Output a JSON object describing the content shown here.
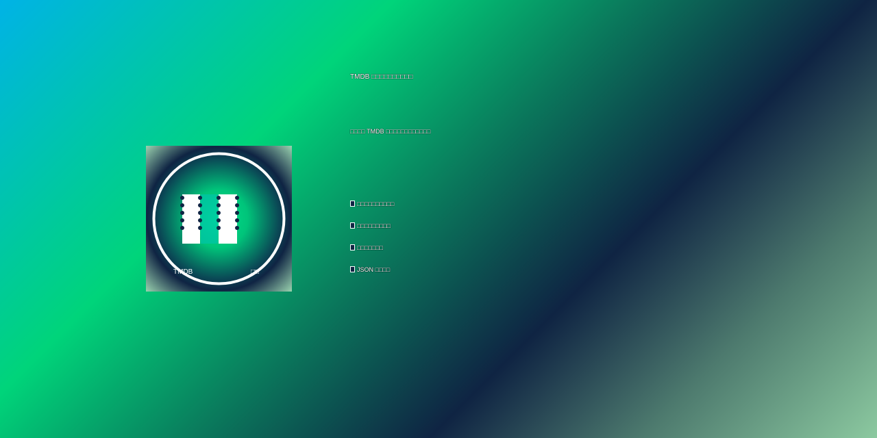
{
  "logo": {
    "left_label": "TMDB",
    "right_label": "□□",
    "colors": {
      "ring": "#ffffff",
      "film_strip": "#ffffff",
      "sprocket": "#0f2443",
      "center_glow": "#00e08a"
    }
  },
  "content": {
    "headline": "TMDB □□□□□□□□□□",
    "subline": "□□□□ TMDB □□□□□□□□□□□□",
    "features": [
      {
        "icon": "checkbox-icon",
        "text": "□□□□□□□□□□"
      },
      {
        "icon": "checkbox-icon",
        "text": "□□□□□□□□□"
      },
      {
        "icon": "checkbox-icon",
        "text": "□□□□□□□"
      },
      {
        "icon": "checkbox-icon",
        "text": "JSON □□□□"
      }
    ]
  },
  "colors": {
    "gradient_start": "#00b3e6",
    "gradient_mid": "#00d47a",
    "gradient_dark": "#0f2443",
    "gradient_end": "#8cc9a0",
    "text": "#ffffff"
  }
}
